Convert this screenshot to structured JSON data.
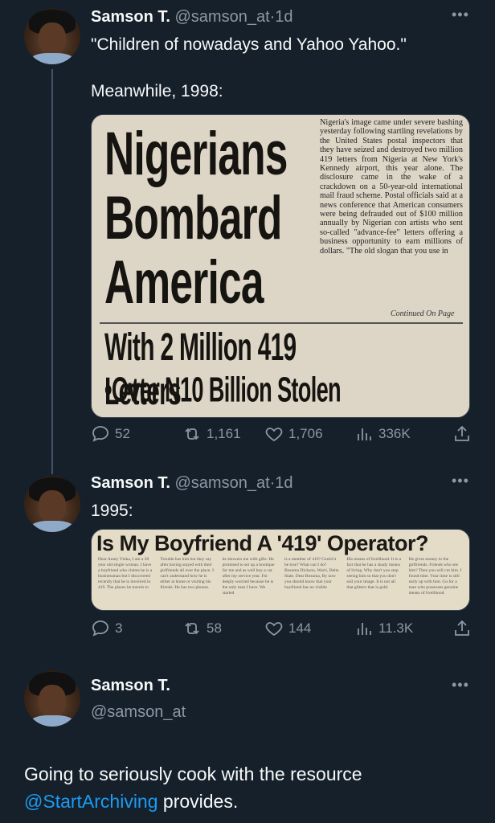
{
  "tweets": [
    {
      "name": "Samson T.",
      "handle": "@samson_at",
      "dot": "·",
      "age": "1d",
      "text_line1": "\"Children of nowadays and Yahoo Yahoo.\"",
      "text_line2": "Meanwhile, 1998:",
      "stats": {
        "replies": "52",
        "retweets": "1,161",
        "likes": "1,706",
        "views": "336K"
      }
    },
    {
      "name": "Samson T.",
      "handle": "@samson_at",
      "dot": "·",
      "age": "1d",
      "text": "1995:",
      "stats": {
        "replies": "3",
        "retweets": "58",
        "likes": "144",
        "views": "11.3K"
      }
    },
    {
      "name": "Samson T.",
      "handle": "@samson_at",
      "text_before": "Going to seriously cook with the resource",
      "mention": "@StartArchiving",
      "text_after": "provides."
    }
  ],
  "clipping_1998": {
    "line1": "Nigerians",
    "line2": "Bombard",
    "line3": "America",
    "line4": "With 2 Million 419 Letters",
    "line5": "•Over N10 Billion Stolen",
    "column": "Nigeria's image came under severe bashing yesterday following startling revelations by the United States postal inspectors that they have seized and destroyed two million 419 letters from Nigeria at New York's Kennedy airport, this year alone. The disclosure came in the wake of a crackdown on a 50-year-old international mail fraud scheme. Postal officials said at a news conference that American consumers were being defrauded out of $100 million annually by Nigerian con artists who sent so-called \"advance-fee\" letters offering a business opportunity to earn millions of dollars. \"The old slogan that you use in",
    "continued": "Continued On Page"
  },
  "clipping_1995": {
    "headline": "Is My Boyfriend A '419' Operator?",
    "columns": [
      "Dear Aunty Yinka, I am a 28 year old single woman. I have a boyfriend who claims he is a businessman but I discovered recently that he is involved in 419. The places he travels to",
      "Trouble has him but they say after having stayed with their girlfriends all over the place. I can't understand how he is either at home or visiting his friends. He has two phones.",
      "he showers me with gifts. He promised to set up a boutique for me and as well buy a car after my service year. I'm deeply worried because he is the only man I have. We started",
      "is a member of 419? Could it be true? What can I do? Bosuma Dickson, Warri, Delta State. Dear Bosuma, By now you should know that your boyfriend has no visible",
      "His means of livelihood. It is a fact that he has a shady means of living. Why don't you stop seeing him so that you don't soil your image. It is not all that glitters that is gold.",
      "He gives money to the girlfriends. Friends who see him? Then you will cut him. I found time. Your time is still early up with him. Go for a man who possesses genuine means of livelihood."
    ]
  }
}
